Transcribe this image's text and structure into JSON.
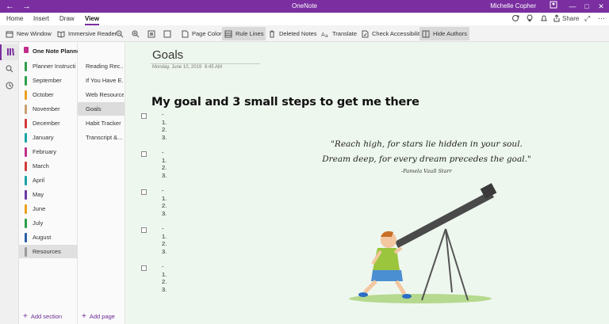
{
  "titlebar": {
    "back_icon": "arrow-left-icon",
    "forward_icon": "arrow-right-icon",
    "app_title": "OneNote",
    "user_name": "Michelle Copher",
    "color": "#7a2ea0"
  },
  "menu": {
    "tabs": [
      "Home",
      "Insert",
      "Draw",
      "View"
    ],
    "active_tab": "View",
    "share_label": "Share"
  },
  "ribbon": {
    "new_window": "New Window",
    "immersive_reader": "Immersive Reader",
    "page_color": "Page Color",
    "rule_lines": "Rule Lines",
    "deleted_notes": "Deleted Notes",
    "translate": "Translate",
    "check_accessibility": "Check Accessibility",
    "hide_authors": "Hide Authors"
  },
  "notebook": {
    "name": "One Note Planner for Layers of L...",
    "sections": [
      {
        "label": "Planner Instructi...",
        "color": "#2e9e4a"
      },
      {
        "label": "September",
        "color": "#2e9e4a"
      },
      {
        "label": "October",
        "color": "#e8a020"
      },
      {
        "label": "November",
        "color": "#c8a070"
      },
      {
        "label": "December",
        "color": "#d23a3a"
      },
      {
        "label": "January",
        "color": "#1aa3a3"
      },
      {
        "label": "February",
        "color": "#c0308a"
      },
      {
        "label": "March",
        "color": "#d23a3a"
      },
      {
        "label": "April",
        "color": "#1aa3a3"
      },
      {
        "label": "May",
        "color": "#6a3aa8"
      },
      {
        "label": "June",
        "color": "#e8a020"
      },
      {
        "label": "July",
        "color": "#2e9e4a"
      },
      {
        "label": "August",
        "color": "#2a5fa8"
      },
      {
        "label": "Resources",
        "color": "#9a9a9a"
      }
    ],
    "active_section": "Resources",
    "add_section": "Add section"
  },
  "pages": {
    "items": [
      "Reading Rec...",
      "If You Have E...",
      "Web Resources",
      "Goals",
      "Habit Tracker",
      "Transcript &..."
    ],
    "active_page": "Goals",
    "add_page": "Add page"
  },
  "page": {
    "title": "Goals",
    "date": "Monday, June 10, 2019",
    "time": "6:45 AM",
    "heading": "My goal and 3 small steps to get me there",
    "goal_lines": [
      "-",
      "1.",
      "2.",
      "3."
    ],
    "quote_line1": "\"Reach high, for stars lie hidden in your soul.",
    "quote_line2": "Dream deep, for every dream precedes the goal.\"",
    "quote_author": "-Pamela Vaull Starr",
    "background": "#eef7ee"
  }
}
